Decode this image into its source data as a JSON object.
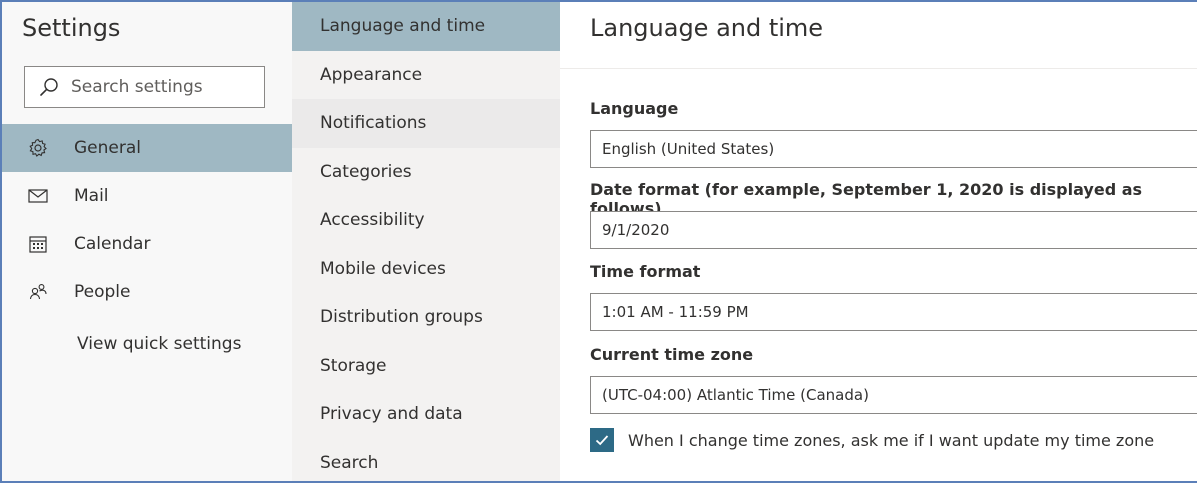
{
  "settings_pane": {
    "title": "Settings",
    "search_placeholder": "Search settings",
    "nav": [
      {
        "label": "General",
        "icon": "gear-icon"
      },
      {
        "label": "Mail",
        "icon": "mail-icon"
      },
      {
        "label": "Calendar",
        "icon": "calendar-icon"
      },
      {
        "label": "People",
        "icon": "people-icon"
      }
    ],
    "quick_settings_link": "View quick settings"
  },
  "category_pane": {
    "items": [
      "Language and time",
      "Appearance",
      "Notifications",
      "Categories",
      "Accessibility",
      "Mobile devices",
      "Distribution groups",
      "Storage",
      "Privacy and data",
      "Search"
    ]
  },
  "content": {
    "title": "Language and time",
    "language": {
      "label": "Language",
      "value": "English (United States)"
    },
    "date_format": {
      "label": "Date format (for example, September 1, 2020 is displayed as follows)",
      "value": "9/1/2020"
    },
    "time_format": {
      "label": "Time format",
      "value": "1:01 AM - 11:59 PM"
    },
    "time_zone": {
      "label": "Current time zone",
      "value": "(UTC-04:00) Atlantic Time (Canada)"
    },
    "ask_update_checkbox": {
      "label": "When I change time zones, ask me if I want update my time zone",
      "checked": true
    }
  },
  "colors": {
    "accent_selected": "#9fb8c3",
    "checkbox_fill": "#2d6a86",
    "window_border": "#5b7fb8"
  }
}
